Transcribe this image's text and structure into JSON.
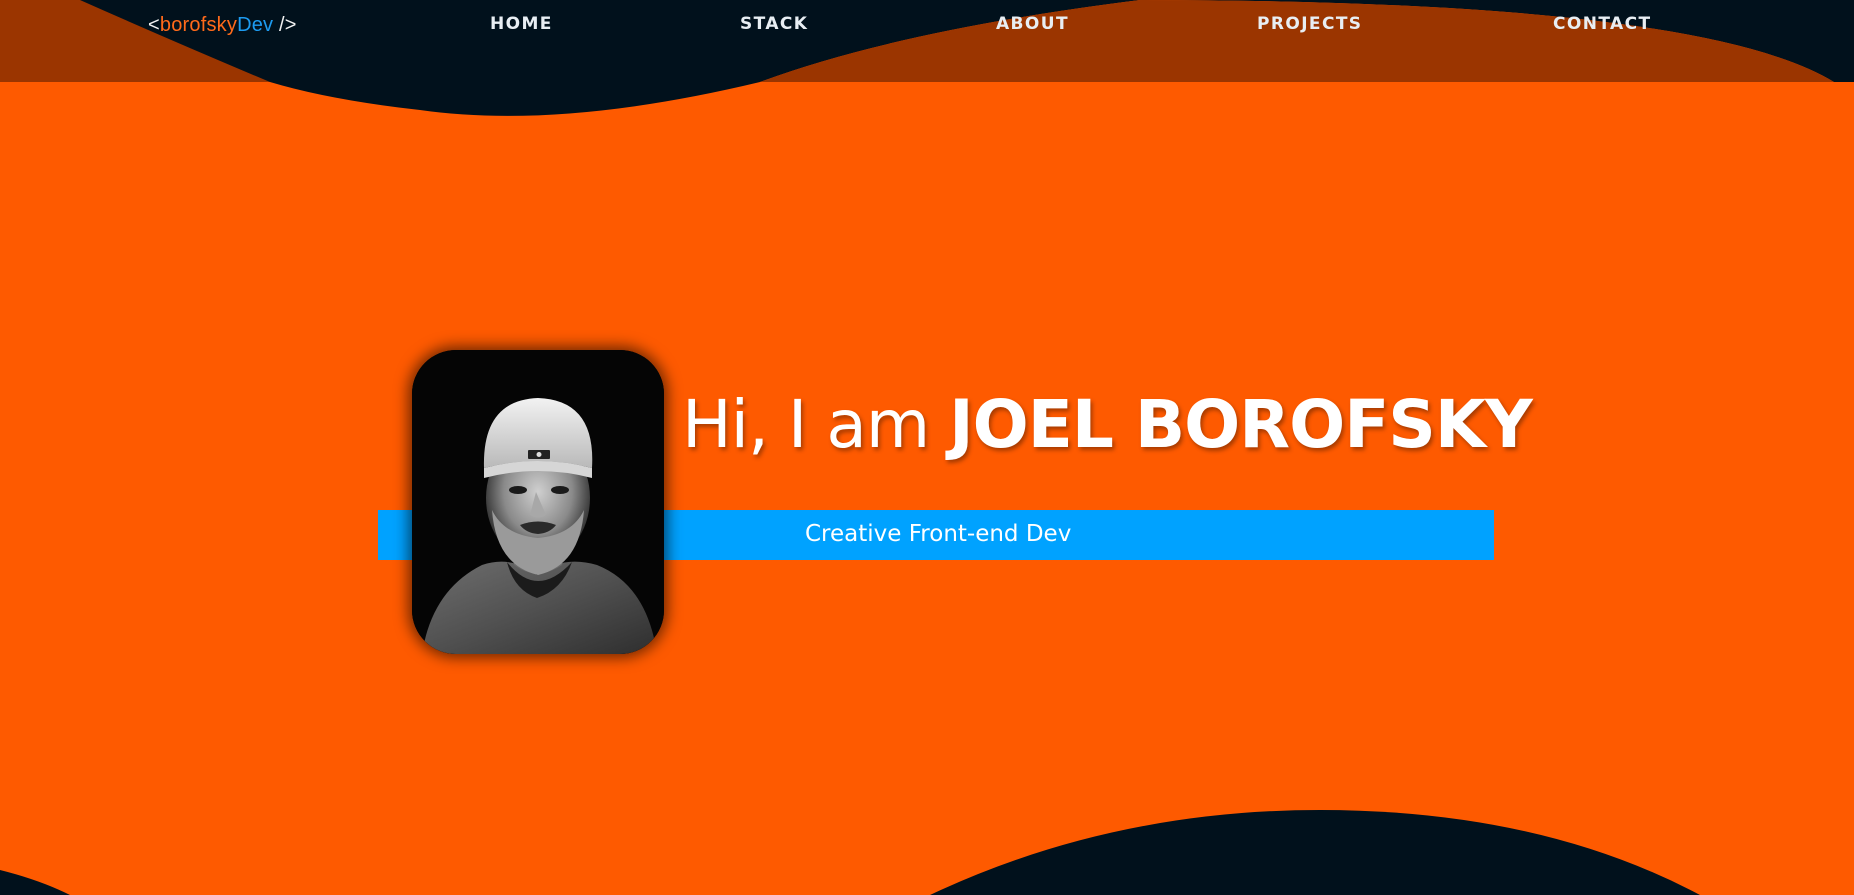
{
  "logo": {
    "open": "<",
    "part1": "borofsky",
    "part2": "Dev",
    "close": " />"
  },
  "nav": {
    "home": "HOME",
    "stack": "STACK",
    "about": "ABOUT",
    "projects": "PROJECTS",
    "contact": "CONTACT"
  },
  "hero": {
    "greeting": "Hi, I am ",
    "name": "JOEL BOROFSKY",
    "subtitle": "Creative Front-end Dev"
  },
  "colors": {
    "background": "#fe5a00",
    "dark_navy": "#01111c",
    "nav_band": "#9b3500",
    "ribbon": "#00a2ff",
    "logo_orange": "#ff6a1a",
    "logo_blue": "#1d9bf0"
  }
}
